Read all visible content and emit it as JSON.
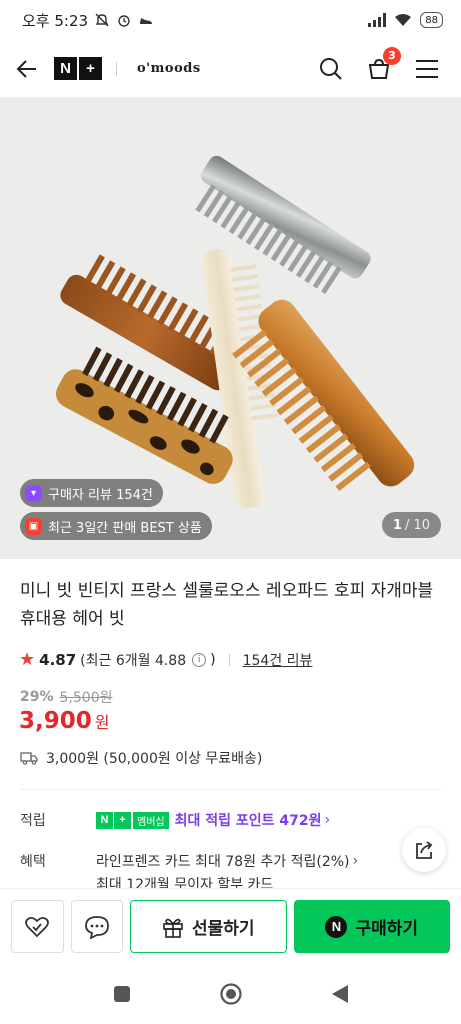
{
  "status_bar": {
    "time": "오후 5:23",
    "battery": "88"
  },
  "header": {
    "brand_logo": "N+",
    "store_name": "o'moods",
    "cart_count": "3"
  },
  "gallery": {
    "chip_reviews": "구매자 리뷰 154건",
    "chip_best": "최근 3일간 판매 BEST 상품",
    "current_page": "1",
    "total_pages": "/ 10"
  },
  "product": {
    "title": "미니 빗 빈티지 프랑스 셀룰로오스 레오파드 호피 자개마블 휴대용 헤어 빗",
    "rating": "4.87",
    "recent_rating": "(최근 6개월 4.88",
    "recent_rating_close": ")",
    "review_count": "154건 리뷰",
    "discount_rate": "29%",
    "original_price": "5,500원",
    "price": "3,900",
    "price_unit": "원",
    "shipping": "3,000원 (50,000원 이상 무료배송)"
  },
  "benefits": {
    "points_label": "적립",
    "membership_badge": "멤버십",
    "points_text": "최대 적립 포인트 472원",
    "benefit_label": "혜택",
    "card_text": "라인프렌즈 카드 최대 78원 추가 적립(2%)",
    "cutoff_text": "최대 12개월 무이자 할부 카드"
  },
  "actions": {
    "gift_label": "선물하기",
    "buy_label": "구매하기"
  },
  "colors": {
    "naver_green": "#03c75a",
    "price_red": "#e5262b",
    "points_purple": "#7b3fe4",
    "badge_red": "#f4402f"
  }
}
